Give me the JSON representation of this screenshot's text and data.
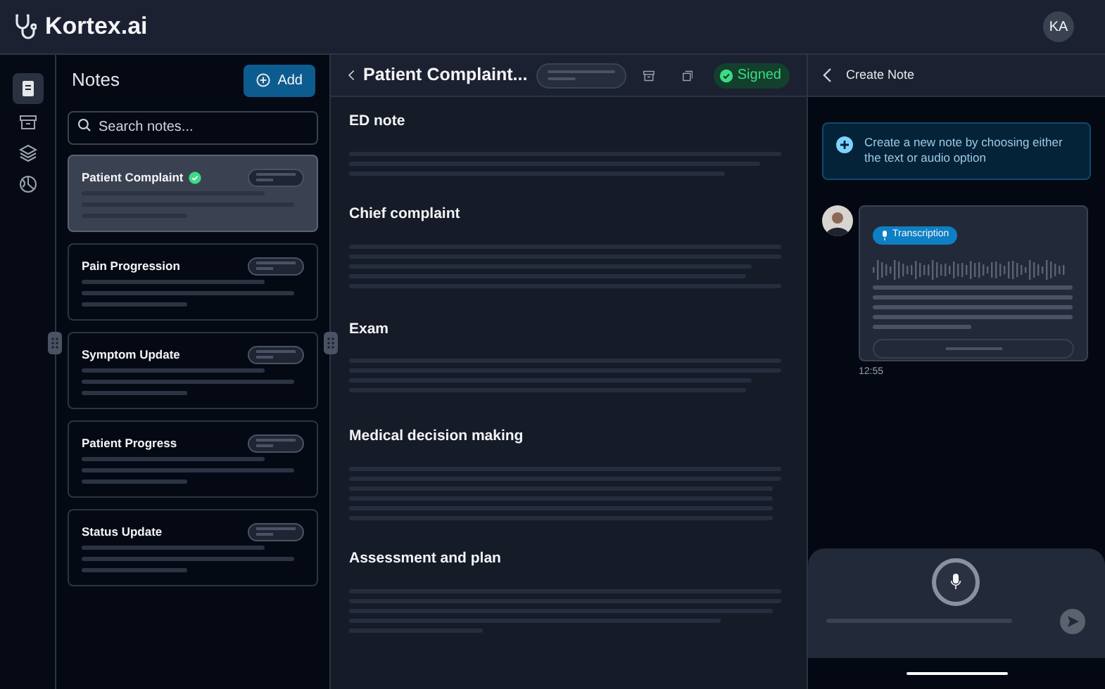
{
  "app": {
    "name": "Kortex.ai",
    "user_initials": "KA"
  },
  "rail": [
    {
      "kind": "note",
      "selected": true
    },
    {
      "kind": "archive",
      "selected": false
    },
    {
      "kind": "layers",
      "selected": false
    },
    {
      "kind": "chart",
      "selected": false
    }
  ],
  "notes_panel": {
    "title": "Notes",
    "add_button": "Add",
    "search": {
      "placeholder": "Search notes..."
    },
    "notes": [
      {
        "title": "Patient Complaint",
        "verified": true,
        "selected": true
      },
      {
        "title": "Pain Progression",
        "verified": false,
        "selected": false
      },
      {
        "title": "Symptom Update",
        "verified": false,
        "selected": false
      },
      {
        "title": "Patient Progress",
        "verified": false,
        "selected": false
      },
      {
        "title": "Status Update",
        "verified": false,
        "selected": false
      }
    ]
  },
  "document": {
    "title": "Patient Complaint...",
    "status": "Signed",
    "sections": [
      {
        "heading": "ED note"
      },
      {
        "heading": "Chief complaint"
      },
      {
        "heading": "Exam"
      },
      {
        "heading": "Medical decision making"
      },
      {
        "heading": "Assessment and plan"
      }
    ]
  },
  "create_panel": {
    "title": "Create Note",
    "info": "Create a new note by choosing either the text or audio option",
    "message": {
      "tag": "Transcription",
      "time": "12:55"
    }
  }
}
